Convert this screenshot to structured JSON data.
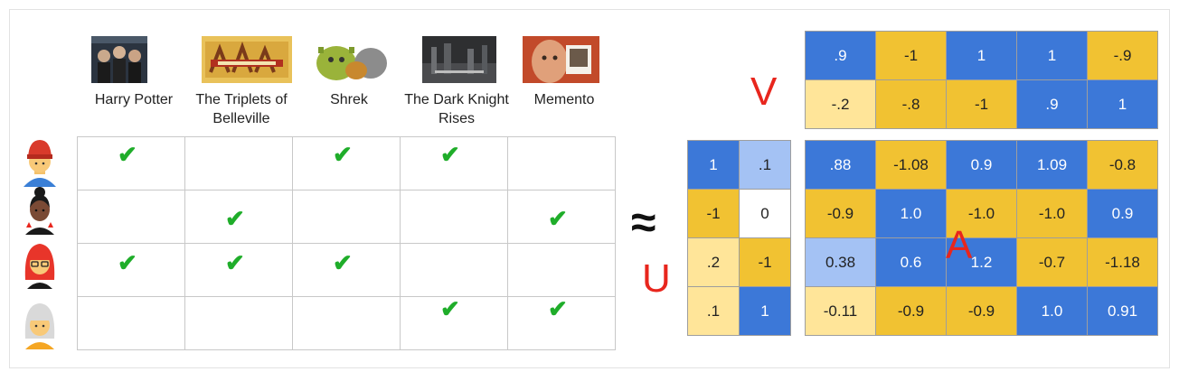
{
  "movies": [
    {
      "title": "Harry Potter",
      "poster_icon": "harry-potter-poster-icon"
    },
    {
      "title": "The Triplets of Belleville",
      "poster_icon": "triplets-poster-icon"
    },
    {
      "title": "Shrek",
      "poster_icon": "shrek-poster-icon"
    },
    {
      "title": "The Dark Knight Rises",
      "poster_icon": "dark-knight-poster-icon"
    },
    {
      "title": "Memento",
      "poster_icon": "memento-poster-icon"
    }
  ],
  "users": [
    "user-red-hat-avatar",
    "user-bun-avatar",
    "user-red-hair-glasses-avatar",
    "user-gray-hair-avatar"
  ],
  "ratings": [
    [
      true,
      false,
      true,
      true,
      false
    ],
    [
      false,
      true,
      false,
      false,
      true
    ],
    [
      true,
      true,
      true,
      false,
      false
    ],
    [
      false,
      false,
      false,
      true,
      true
    ]
  ],
  "check_symbol": "✔",
  "approx_symbol": "≈",
  "labels": {
    "U": "U",
    "V": "V",
    "A": "A"
  },
  "colors": {
    "blue": "#3c78d8",
    "light_blue": "#a4c2f4",
    "gold": "#f1c232",
    "pale_gold": "#ffe599",
    "check": "#1fad2a",
    "label_red": "#e8261d"
  },
  "V": {
    "rows": [
      [
        {
          "v": ".9",
          "c": "blue"
        },
        {
          "v": "-1",
          "c": "gold"
        },
        {
          "v": "1",
          "c": "blue"
        },
        {
          "v": "1",
          "c": "blue"
        },
        {
          "v": "-.9",
          "c": "gold"
        }
      ],
      [
        {
          "v": "-.2",
          "c": "pale"
        },
        {
          "v": "-.8",
          "c": "gold"
        },
        {
          "v": "-1",
          "c": "gold"
        },
        {
          "v": ".9",
          "c": "blue"
        },
        {
          "v": "1",
          "c": "blue"
        }
      ]
    ]
  },
  "U": {
    "rows": [
      [
        {
          "v": "1",
          "c": "blue"
        },
        {
          "v": ".1",
          "c": "light"
        }
      ],
      [
        {
          "v": "-1",
          "c": "gold"
        },
        {
          "v": "0",
          "c": "white"
        }
      ],
      [
        {
          "v": ".2",
          "c": "pale"
        },
        {
          "v": "-1",
          "c": "gold"
        }
      ],
      [
        {
          "v": ".1",
          "c": "pale"
        },
        {
          "v": "1",
          "c": "blue"
        }
      ]
    ]
  },
  "A": {
    "rows": [
      [
        {
          "v": ".88",
          "c": "blue"
        },
        {
          "v": "-1.08",
          "c": "gold"
        },
        {
          "v": "0.9",
          "c": "blue"
        },
        {
          "v": "1.09",
          "c": "blue"
        },
        {
          "v": "-0.8",
          "c": "gold"
        }
      ],
      [
        {
          "v": "-0.9",
          "c": "gold"
        },
        {
          "v": "1.0",
          "c": "blue"
        },
        {
          "v": "-1.0",
          "c": "gold"
        },
        {
          "v": "-1.0",
          "c": "gold"
        },
        {
          "v": "0.9",
          "c": "blue"
        }
      ],
      [
        {
          "v": "0.38",
          "c": "light"
        },
        {
          "v": "0.6",
          "c": "blue"
        },
        {
          "v": "1.2",
          "c": "blue"
        },
        {
          "v": "-0.7",
          "c": "gold"
        },
        {
          "v": "-1.18",
          "c": "gold"
        }
      ],
      [
        {
          "v": "-0.11",
          "c": "pale"
        },
        {
          "v": "-0.9",
          "c": "gold"
        },
        {
          "v": "-0.9",
          "c": "gold"
        },
        {
          "v": "1.0",
          "c": "blue"
        },
        {
          "v": "0.91",
          "c": "blue"
        }
      ]
    ]
  }
}
